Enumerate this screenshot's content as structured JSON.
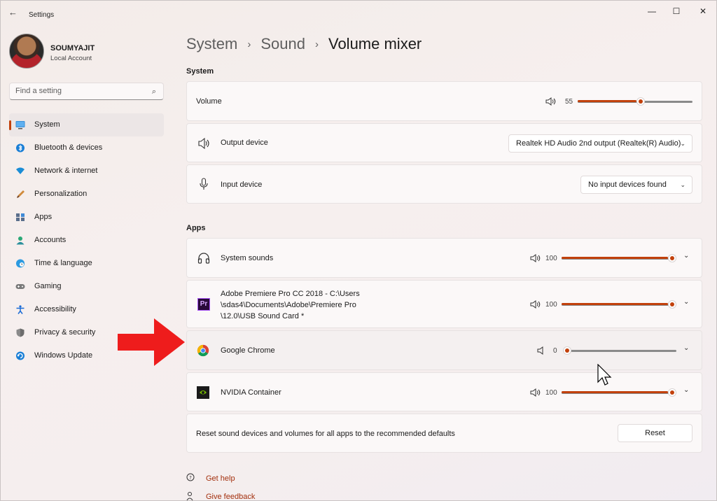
{
  "window": {
    "title": "Settings",
    "back": "←",
    "minimize": "—",
    "maximize": "☐",
    "close": "✕"
  },
  "user": {
    "name": "SOUMYAJIT",
    "type": "Local Account"
  },
  "search": {
    "placeholder": "Find a setting",
    "icon": "⌕"
  },
  "nav": [
    {
      "label": "System",
      "active": true,
      "icon": "monitor-icon",
      "color": "#0078d4"
    },
    {
      "label": "Bluetooth & devices",
      "icon": "bluetooth-icon",
      "color": "#0078d4"
    },
    {
      "label": "Network & internet",
      "icon": "wifi-icon",
      "color": "#0078d4"
    },
    {
      "label": "Personalization",
      "icon": "brush-icon",
      "color": "#c97a2b"
    },
    {
      "label": "Apps",
      "icon": "apps-icon",
      "color": "#4a5d7a"
    },
    {
      "label": "Accounts",
      "icon": "person-icon",
      "color": "#2aa876"
    },
    {
      "label": "Time & language",
      "icon": "globe-clock-icon",
      "color": "#1a8dd6"
    },
    {
      "label": "Gaming",
      "icon": "gamepad-icon",
      "color": "#6b6b6b"
    },
    {
      "label": "Accessibility",
      "icon": "accessibility-icon",
      "color": "#1a6bd6"
    },
    {
      "label": "Privacy & security",
      "icon": "shield-icon",
      "color": "#6b6b6b"
    },
    {
      "label": "Windows Update",
      "icon": "update-icon",
      "color": "#1a7fd6"
    }
  ],
  "breadcrumb": {
    "level1": "System",
    "level2": "Sound",
    "current": "Volume mixer",
    "sep": "›"
  },
  "system_section": {
    "title": "System",
    "volume": {
      "label": "Volume",
      "value": "55",
      "level": 0.55,
      "icon": "🔊"
    },
    "output": {
      "label": "Output device",
      "value": "Realtek HD Audio 2nd output (Realtek(R) Audio)"
    },
    "input": {
      "label": "Input device",
      "value": "No input devices found"
    }
  },
  "apps_section": {
    "title": "Apps",
    "apps": [
      {
        "label": "System sounds",
        "value": "100",
        "level": 1.0
      },
      {
        "label_lines": [
          "Adobe Premiere Pro CC 2018 - C:\\Users",
          "\\sdas4\\Documents\\Adobe\\Premiere Pro",
          "\\12.0\\USB Sound Card *"
        ],
        "value": "100",
        "level": 1.0
      },
      {
        "label": "Google Chrome",
        "value": "0",
        "level": 0.0
      },
      {
        "label": "NVIDIA Container",
        "value": "100",
        "level": 1.0
      }
    ]
  },
  "reset": {
    "text": "Reset sound devices and volumes for all apps to the recommended defaults",
    "button": "Reset"
  },
  "links": {
    "help": "Get help",
    "feedback": "Give feedback"
  },
  "glyphs": {
    "chevron_down": "⌄",
    "speaker": "🔈"
  },
  "colors": {
    "accent": "#c2410c",
    "arrow": "#ee1c1c"
  }
}
